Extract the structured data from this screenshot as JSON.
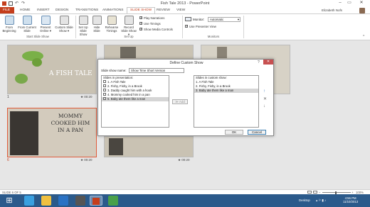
{
  "window": {
    "title": "Fish Tale 2013 - PowerPoint",
    "user_name": "Elizabeth Nofs"
  },
  "tabs": [
    "FILE",
    "HOME",
    "INSERT",
    "DESIGN",
    "TRANSITIONS",
    "ANIMATIONS",
    "SLIDE SHOW",
    "REVIEW",
    "VIEW"
  ],
  "ribbon": {
    "start_group": {
      "from_beginning": "From Beginning",
      "from_current": "From Current Slide",
      "present_online": "Present Online ▾",
      "custom_show": "Custom Slide Show ▾",
      "label": "Start Slide Show"
    },
    "setup_group": {
      "setup_show": "Set Up Slide Show",
      "hide_slide": "Hide Slide",
      "rehearse": "Rehearse Timings",
      "record": "Record Slide Show ▾",
      "play_narrations": "Play Narrations",
      "use_timings": "Use Timings",
      "show_media": "Show Media Controls",
      "label": "Set Up"
    },
    "monitors_group": {
      "monitor_label": "Monitor:",
      "monitor_value": "Automatic",
      "presenter_view": "Use Presenter View",
      "label": "Monitors"
    }
  },
  "slides": [
    {
      "num": "1",
      "time": "00:20",
      "title": "A FISH TALE"
    },
    {
      "num": "6",
      "time": "00:20",
      "title": "MOMMY COOKED HIM IN A PAN"
    },
    {
      "num": "",
      "time": "00:20"
    },
    {
      "num": "",
      "time": "00:20"
    }
  ],
  "dialog": {
    "title": "Define Custom Show",
    "help": "?",
    "close": "✕",
    "name_label": "Slide show name:",
    "name_value": "Show Time Short Version",
    "left_header": "Slides in presentation:",
    "left_items": [
      "1. A Fish Tale",
      "2. Fishy, Fishy, in a Brook",
      "3. Daddy caught him with a hook",
      "4. Mommy cooked him in a pan",
      "5. Baby ate them like a man"
    ],
    "add_button": "Add",
    "right_header": "Slides in custom show:",
    "right_items": [
      "1. A Fish Tale",
      "2. Fishy, Fishy, in a Brook",
      "3. Baby ate them like a man"
    ],
    "ok": "OK",
    "cancel": "Cancel"
  },
  "status": {
    "slide_info": "SLIDE 6 OF 5",
    "zoom": "100%"
  },
  "taskbar": {
    "desktop": "Desktop",
    "time": "4:56 PM",
    "date": "11/10/2013"
  },
  "colors": {
    "accent": "#c43e1c",
    "taskbar": "#2b5a8b"
  }
}
